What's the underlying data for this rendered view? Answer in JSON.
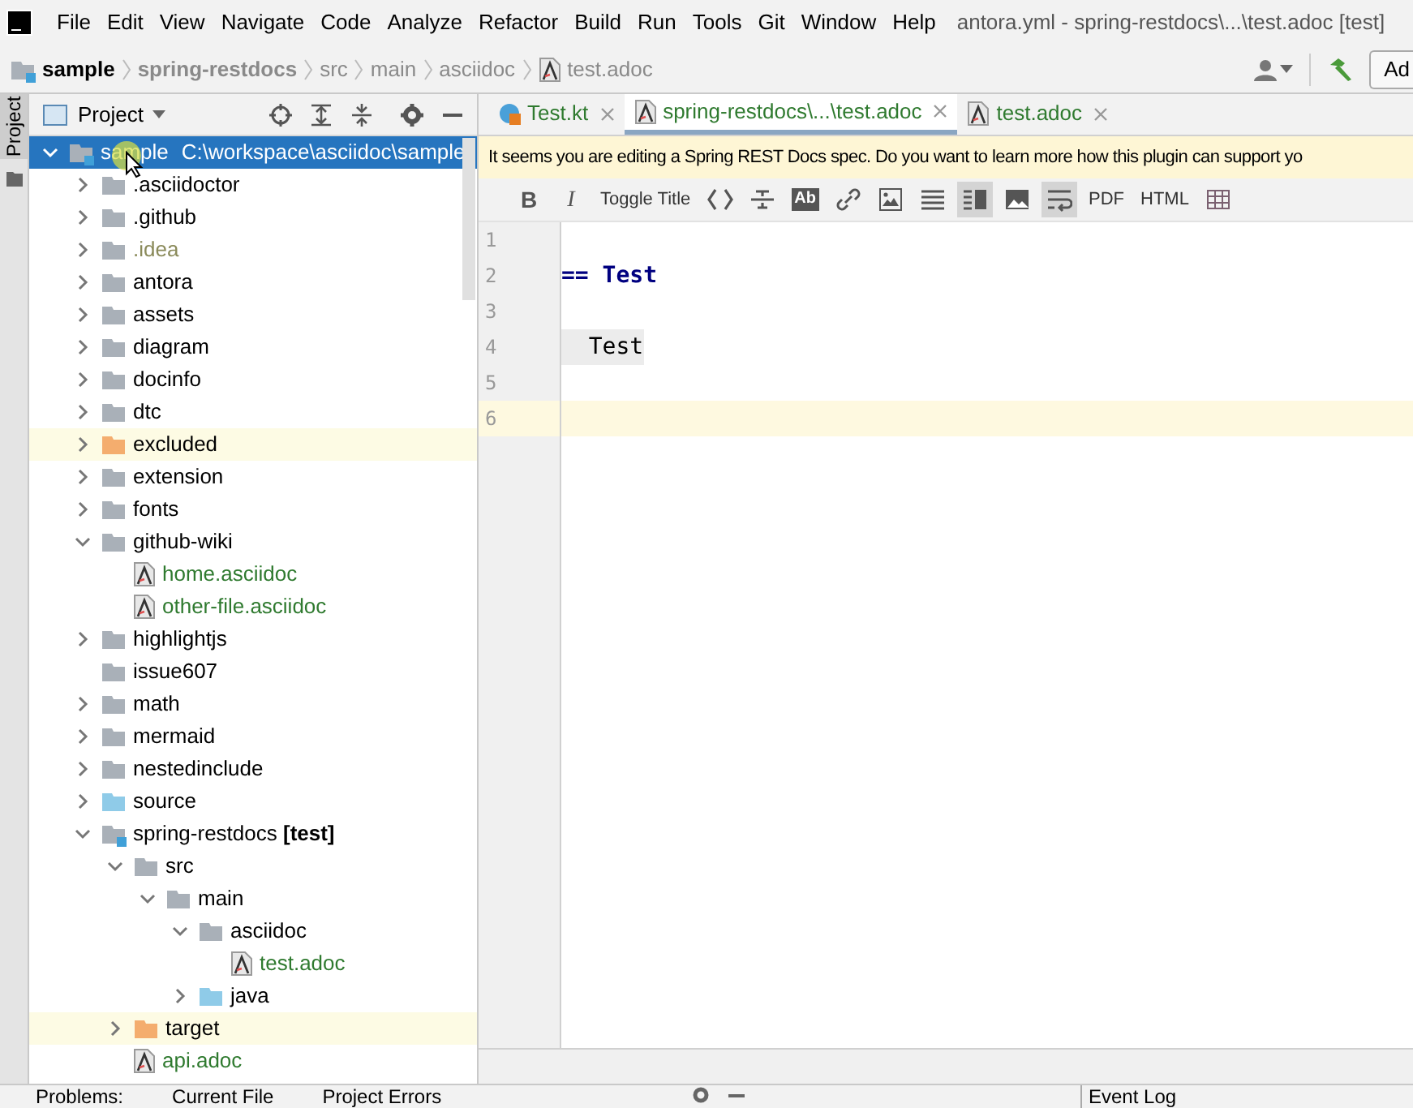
{
  "menu": [
    "File",
    "Edit",
    "View",
    "Navigate",
    "Code",
    "Analyze",
    "Refactor",
    "Build",
    "Run",
    "Tools",
    "Git",
    "Window",
    "Help"
  ],
  "window": {
    "title": "antora.yml - spring-restdocs\\...\\test.adoc [test]"
  },
  "breadcrumbs": [
    {
      "label": "sample",
      "kind": "project"
    },
    {
      "label": "spring-restdocs",
      "kind": "module"
    },
    {
      "label": "src",
      "kind": "folder"
    },
    {
      "label": "main",
      "kind": "folder"
    },
    {
      "label": "asciidoc",
      "kind": "folder"
    },
    {
      "label": "test.adoc",
      "kind": "file"
    }
  ],
  "toolbar_button": "Ad",
  "project_panel": {
    "side_tab": "Project",
    "view": "Project",
    "tree": [
      {
        "label": "sample",
        "path": "C:\\workspace\\asciidoc\\sample",
        "kind": "module",
        "expanded": true,
        "selected": true,
        "children": [
          {
            "label": ".asciidoctor",
            "kind": "folder",
            "expanded": false,
            "selected": false
          },
          {
            "label": ".github",
            "kind": "folder",
            "expanded": false,
            "selected": false
          },
          {
            "label": ".idea",
            "kind": "folder",
            "expanded": false,
            "selected": false,
            "ignored": true
          },
          {
            "label": "antora",
            "kind": "folder",
            "expanded": false,
            "selected": false
          },
          {
            "label": "assets",
            "kind": "folder",
            "expanded": false,
            "selected": false
          },
          {
            "label": "diagram",
            "kind": "folder",
            "expanded": false,
            "selected": false
          },
          {
            "label": "docinfo",
            "kind": "folder",
            "expanded": false,
            "selected": false
          },
          {
            "label": "dtc",
            "kind": "folder",
            "expanded": false,
            "selected": false
          },
          {
            "label": "excluded",
            "kind": "excluded",
            "expanded": false,
            "selected": false
          },
          {
            "label": "extension",
            "kind": "folder",
            "expanded": false,
            "selected": false
          },
          {
            "label": "fonts",
            "kind": "folder",
            "expanded": false,
            "selected": false
          },
          {
            "label": "github-wiki",
            "kind": "folder",
            "expanded": true,
            "selected": false,
            "children": [
              {
                "label": "home.asciidoc",
                "kind": "file",
                "selected": false
              },
              {
                "label": "other-file.asciidoc",
                "kind": "file",
                "selected": false
              }
            ]
          },
          {
            "label": "highlightjs",
            "kind": "folder",
            "expanded": false,
            "selected": false
          },
          {
            "label": "issue607",
            "kind": "folder",
            "selected": false
          },
          {
            "label": "math",
            "kind": "folder",
            "expanded": false,
            "selected": false
          },
          {
            "label": "mermaid",
            "kind": "folder",
            "expanded": false,
            "selected": false
          },
          {
            "label": "nestedinclude",
            "kind": "folder",
            "expanded": false,
            "selected": false
          },
          {
            "label": "source",
            "kind": "source",
            "expanded": false,
            "selected": false
          },
          {
            "label": "spring-restdocs **[test]**",
            "kind": "module",
            "expanded": true,
            "selected": false,
            "children": [
              {
                "label": "src",
                "kind": "folder",
                "expanded": true,
                "selected": false,
                "children": [
                  {
                    "label": "main",
                    "kind": "folder",
                    "expanded": true,
                    "selected": false,
                    "children": [
                      {
                        "label": "asciidoc",
                        "kind": "folder",
                        "expanded": true,
                        "selected": false,
                        "children": [
                          {
                            "label": "test.adoc",
                            "kind": "file",
                            "selected": false
                          }
                        ]
                      },
                      {
                        "label": "java",
                        "kind": "source",
                        "expanded": false,
                        "selected": false
                      }
                    ]
                  }
                ]
              },
              {
                "label": "target",
                "kind": "excluded",
                "expanded": false,
                "selected": false
              },
              {
                "label": "api.adoc",
                "kind": "file",
                "selected": false
              }
            ]
          }
        ]
      }
    ]
  },
  "editor": {
    "tabs": [
      {
        "label": "Test.kt",
        "kind": "kotlin",
        "selected": false
      },
      {
        "label": "spring-restdocs\\...\\test.adoc",
        "kind": "asciidoc",
        "selected": true
      },
      {
        "label": "test.adoc",
        "kind": "asciidoc",
        "selected": false
      }
    ],
    "banner": "It seems you are editing a Spring REST Docs spec. Do you want to learn more how this plugin can support yo",
    "toolbar": [
      {
        "kind": "bold",
        "label": "B",
        "pressed": false
      },
      {
        "kind": "italic",
        "label": "I",
        "pressed": false
      },
      {
        "kind": "text",
        "label": "Toggle Title",
        "pressed": false
      },
      {
        "kind": "icon",
        "pressed": false
      },
      {
        "kind": "icon",
        "pressed": false
      },
      {
        "kind": "badge",
        "label": "Ab",
        "pressed": false
      },
      {
        "kind": "icon",
        "pressed": false
      },
      {
        "kind": "icon",
        "pressed": false
      },
      {
        "kind": "icon",
        "pressed": false
      },
      {
        "kind": "icon",
        "pressed": true
      },
      {
        "kind": "icon",
        "pressed": false
      },
      {
        "kind": "icon",
        "pressed": true
      },
      {
        "kind": "text",
        "label": "PDF",
        "pressed": false
      },
      {
        "kind": "text",
        "label": "HTML",
        "pressed": false
      },
      {
        "kind": "icon",
        "pressed": false
      }
    ],
    "lines": [
      {
        "number": "1",
        "current": false
      },
      {
        "number": "2",
        "kind": "heading",
        "text": "== Test",
        "current": false
      },
      {
        "number": "3",
        "current": false
      },
      {
        "number": "4",
        "kind": "literal",
        "text": "  Test",
        "current": false
      },
      {
        "number": "5",
        "current": false
      },
      {
        "number": "6",
        "current": true
      }
    ]
  },
  "bottom_bar": {
    "tabs": [
      "Problems:",
      "Current File",
      "Project Errors"
    ],
    "right_tab": "Event Log"
  }
}
